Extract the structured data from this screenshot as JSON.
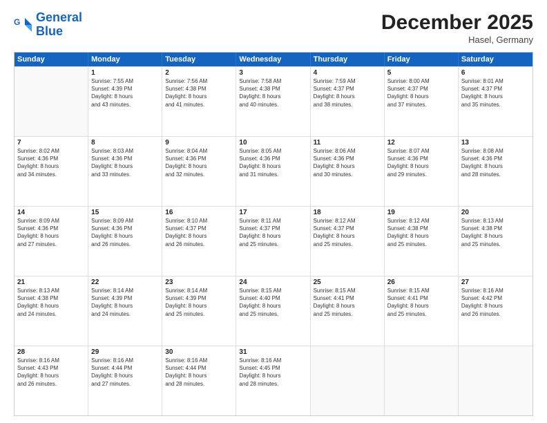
{
  "header": {
    "logo_line1": "General",
    "logo_line2": "Blue",
    "month": "December 2025",
    "location": "Hasel, Germany"
  },
  "weekdays": [
    "Sunday",
    "Monday",
    "Tuesday",
    "Wednesday",
    "Thursday",
    "Friday",
    "Saturday"
  ],
  "weeks": [
    [
      {
        "day": "",
        "info": ""
      },
      {
        "day": "1",
        "info": "Sunrise: 7:55 AM\nSunset: 4:39 PM\nDaylight: 8 hours\nand 43 minutes."
      },
      {
        "day": "2",
        "info": "Sunrise: 7:56 AM\nSunset: 4:38 PM\nDaylight: 8 hours\nand 41 minutes."
      },
      {
        "day": "3",
        "info": "Sunrise: 7:58 AM\nSunset: 4:38 PM\nDaylight: 8 hours\nand 40 minutes."
      },
      {
        "day": "4",
        "info": "Sunrise: 7:59 AM\nSunset: 4:37 PM\nDaylight: 8 hours\nand 38 minutes."
      },
      {
        "day": "5",
        "info": "Sunrise: 8:00 AM\nSunset: 4:37 PM\nDaylight: 8 hours\nand 37 minutes."
      },
      {
        "day": "6",
        "info": "Sunrise: 8:01 AM\nSunset: 4:37 PM\nDaylight: 8 hours\nand 35 minutes."
      }
    ],
    [
      {
        "day": "7",
        "info": "Sunrise: 8:02 AM\nSunset: 4:36 PM\nDaylight: 8 hours\nand 34 minutes."
      },
      {
        "day": "8",
        "info": "Sunrise: 8:03 AM\nSunset: 4:36 PM\nDaylight: 8 hours\nand 33 minutes."
      },
      {
        "day": "9",
        "info": "Sunrise: 8:04 AM\nSunset: 4:36 PM\nDaylight: 8 hours\nand 32 minutes."
      },
      {
        "day": "10",
        "info": "Sunrise: 8:05 AM\nSunset: 4:36 PM\nDaylight: 8 hours\nand 31 minutes."
      },
      {
        "day": "11",
        "info": "Sunrise: 8:06 AM\nSunset: 4:36 PM\nDaylight: 8 hours\nand 30 minutes."
      },
      {
        "day": "12",
        "info": "Sunrise: 8:07 AM\nSunset: 4:36 PM\nDaylight: 8 hours\nand 29 minutes."
      },
      {
        "day": "13",
        "info": "Sunrise: 8:08 AM\nSunset: 4:36 PM\nDaylight: 8 hours\nand 28 minutes."
      }
    ],
    [
      {
        "day": "14",
        "info": "Sunrise: 8:09 AM\nSunset: 4:36 PM\nDaylight: 8 hours\nand 27 minutes."
      },
      {
        "day": "15",
        "info": "Sunrise: 8:09 AM\nSunset: 4:36 PM\nDaylight: 8 hours\nand 26 minutes."
      },
      {
        "day": "16",
        "info": "Sunrise: 8:10 AM\nSunset: 4:37 PM\nDaylight: 8 hours\nand 26 minutes."
      },
      {
        "day": "17",
        "info": "Sunrise: 8:11 AM\nSunset: 4:37 PM\nDaylight: 8 hours\nand 25 minutes."
      },
      {
        "day": "18",
        "info": "Sunrise: 8:12 AM\nSunset: 4:37 PM\nDaylight: 8 hours\nand 25 minutes."
      },
      {
        "day": "19",
        "info": "Sunrise: 8:12 AM\nSunset: 4:38 PM\nDaylight: 8 hours\nand 25 minutes."
      },
      {
        "day": "20",
        "info": "Sunrise: 8:13 AM\nSunset: 4:38 PM\nDaylight: 8 hours\nand 25 minutes."
      }
    ],
    [
      {
        "day": "21",
        "info": "Sunrise: 8:13 AM\nSunset: 4:38 PM\nDaylight: 8 hours\nand 24 minutes."
      },
      {
        "day": "22",
        "info": "Sunrise: 8:14 AM\nSunset: 4:39 PM\nDaylight: 8 hours\nand 24 minutes."
      },
      {
        "day": "23",
        "info": "Sunrise: 8:14 AM\nSunset: 4:39 PM\nDaylight: 8 hours\nand 25 minutes."
      },
      {
        "day": "24",
        "info": "Sunrise: 8:15 AM\nSunset: 4:40 PM\nDaylight: 8 hours\nand 25 minutes."
      },
      {
        "day": "25",
        "info": "Sunrise: 8:15 AM\nSunset: 4:41 PM\nDaylight: 8 hours\nand 25 minutes."
      },
      {
        "day": "26",
        "info": "Sunrise: 8:15 AM\nSunset: 4:41 PM\nDaylight: 8 hours\nand 25 minutes."
      },
      {
        "day": "27",
        "info": "Sunrise: 8:16 AM\nSunset: 4:42 PM\nDaylight: 8 hours\nand 26 minutes."
      }
    ],
    [
      {
        "day": "28",
        "info": "Sunrise: 8:16 AM\nSunset: 4:43 PM\nDaylight: 8 hours\nand 26 minutes."
      },
      {
        "day": "29",
        "info": "Sunrise: 8:16 AM\nSunset: 4:44 PM\nDaylight: 8 hours\nand 27 minutes."
      },
      {
        "day": "30",
        "info": "Sunrise: 8:16 AM\nSunset: 4:44 PM\nDaylight: 8 hours\nand 28 minutes."
      },
      {
        "day": "31",
        "info": "Sunrise: 8:16 AM\nSunset: 4:45 PM\nDaylight: 8 hours\nand 28 minutes."
      },
      {
        "day": "",
        "info": ""
      },
      {
        "day": "",
        "info": ""
      },
      {
        "day": "",
        "info": ""
      }
    ]
  ]
}
